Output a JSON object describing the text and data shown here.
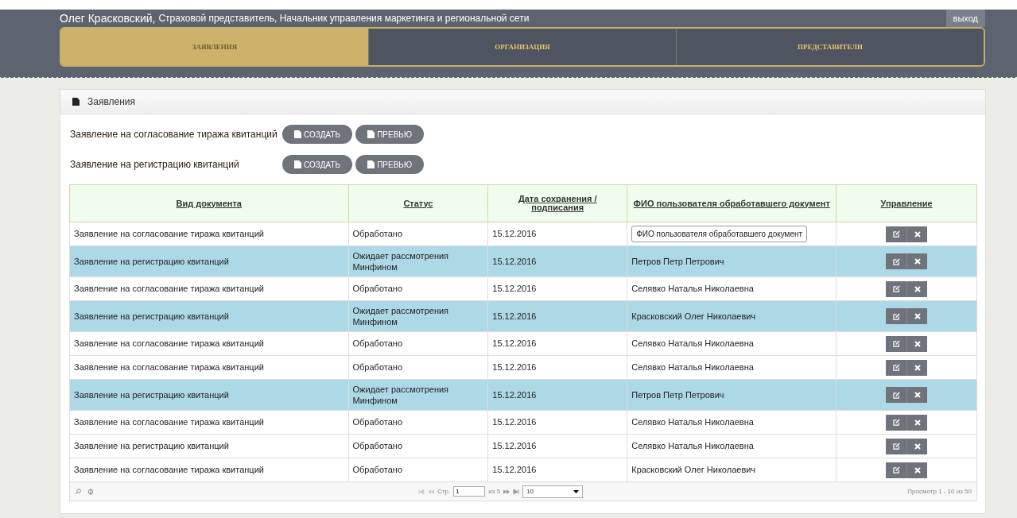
{
  "header": {
    "user_name": "Олег Красковский,",
    "user_role": "Страховой представитель, Начальник управления маркетинга и региональной сети",
    "logout": "выход"
  },
  "tabs": [
    {
      "label": "ЗАЯВЛЕНИЯ",
      "selected": true
    },
    {
      "label": "ОРГАНИЗАЦИЯ",
      "selected": false
    },
    {
      "label": "ПРЕДСТАВИТЕЛИ",
      "selected": false
    }
  ],
  "panel": {
    "title": "Заявления",
    "actions": [
      {
        "label": "Заявление на согласование тиража квитанций",
        "buttons": [
          "СОЗДАТЬ",
          "ПРЕВЬЮ"
        ]
      },
      {
        "label": "Заявление на регистрацию квитанций",
        "buttons": [
          "СОЗДАТЬ",
          "ПРЕВЬЮ"
        ]
      }
    ]
  },
  "table": {
    "columns": [
      "Вид документа",
      "Статус",
      "Дата сохранения / подписания",
      "ФИО пользователя обработавшего документ",
      "Управление"
    ],
    "rows": [
      {
        "type": "Заявление на согласование тиража квитанций",
        "status": "Обработано",
        "date": "15.12.2016",
        "tooltip": "ФИО пользователя обработавшего документ",
        "highlighted": false
      },
      {
        "type": "Заявление на регистрацию квитанций",
        "status": "Ожидает рассмотрения Минфином",
        "date": "15.12.2016",
        "user": "Петров Петр Петрович",
        "highlighted": true
      },
      {
        "type": "Заявление на согласование тиража квитанций",
        "status": "Обработано",
        "date": "15.12.2016",
        "user": "Селявко Наталья Николаевна",
        "highlighted": false
      },
      {
        "type": "Заявление на регистрацию квитанций",
        "status": "Ожидает рассмотрения Минфином",
        "date": "15.12.2016",
        "user": "Красковский Олег Николаевич",
        "highlighted": true
      },
      {
        "type": "Заявление на согласование тиража квитанций",
        "status": "Обработано",
        "date": "15.12.2016",
        "user": "Селявко Наталья Николаевна",
        "highlighted": false
      },
      {
        "type": "Заявление на согласование тиража квитанций",
        "status": "Обработано",
        "date": "15.12.2016",
        "user": "Селявко Наталья Николаевна",
        "highlighted": false
      },
      {
        "type": "Заявление на регистрацию квитанций",
        "status": "Ожидает рассмотрения Минфином",
        "date": "15.12.2016",
        "user": "Петров Петр Петрович",
        "highlighted": true
      },
      {
        "type": "Заявление на согласование тиража квитанций",
        "status": "Обработано",
        "date": "15.12.2016",
        "user": "Селявко Наталья Николаевна",
        "highlighted": false
      },
      {
        "type": "Заявление на регистрацию квитанций",
        "status": "Обработано",
        "date": "15.12.2016",
        "user": "Селявко Наталья Николаевна",
        "highlighted": false
      },
      {
        "type": "Заявление на согласование тиража квитанций",
        "status": "Обработано",
        "date": "15.12.2016",
        "user": "Красковский Олег Николаевич",
        "highlighted": false
      }
    ]
  },
  "pager": {
    "page_label": "Стр.",
    "page": "1",
    "of_pages": "из 5",
    "page_size": "10",
    "summary": "Просмотр 1 - 10 из 50"
  }
}
